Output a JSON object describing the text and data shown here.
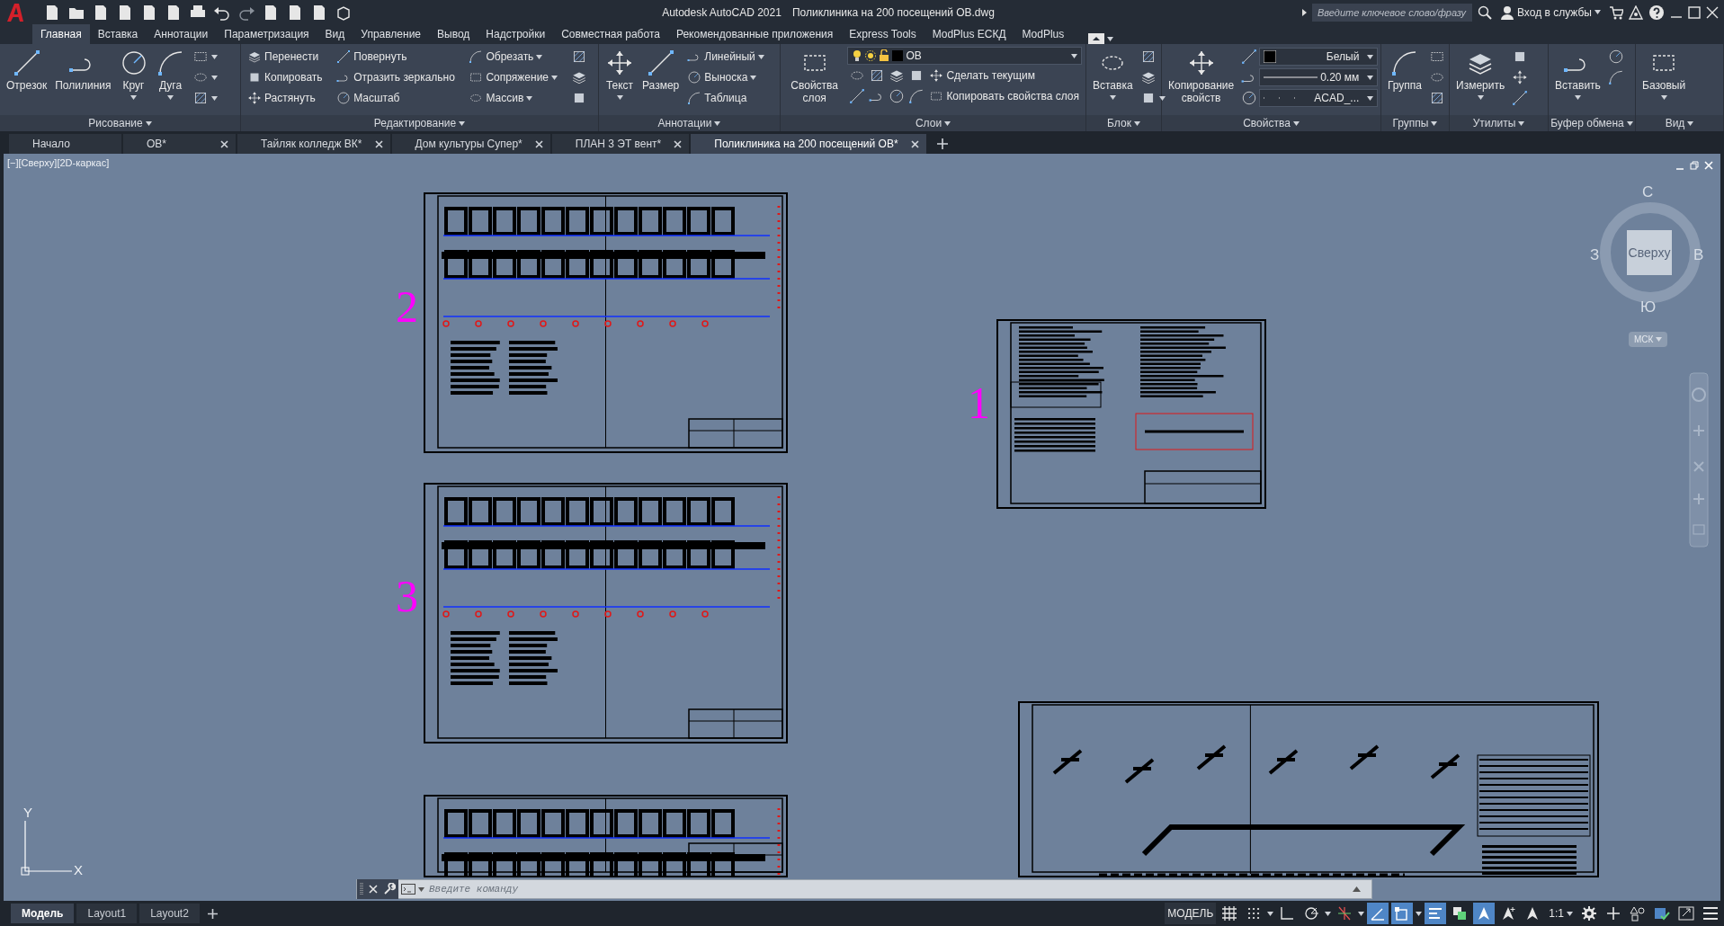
{
  "title_bar": {
    "app_title": "Autodesk AutoCAD 2021",
    "file_name": "Поликлиника на 200 посещений ОВ.dwg",
    "search": {
      "placeholder": "Введите ключевое слово/фразу"
    },
    "sign_in": "Вход в службы"
  },
  "ribbon_tabs": [
    {
      "label": "Главная",
      "selected": true
    },
    {
      "label": "Вставка",
      "selected": false
    },
    {
      "label": "Аннотации",
      "selected": false
    },
    {
      "label": "Параметризация",
      "selected": false
    },
    {
      "label": "Вид",
      "selected": false
    },
    {
      "label": "Управление",
      "selected": false
    },
    {
      "label": "Вывод",
      "selected": false
    },
    {
      "label": "Надстройки",
      "selected": false
    },
    {
      "label": "Совместная работа",
      "selected": false
    },
    {
      "label": "Рекомендованные приложения",
      "selected": false
    },
    {
      "label": "Express Tools",
      "selected": false
    },
    {
      "label": "ModPlus ЕСКД",
      "selected": false
    },
    {
      "label": "ModPlus",
      "selected": false
    }
  ],
  "ribbon_panels": [
    {
      "title": "Рисование",
      "tools": [
        {
          "kind": "large",
          "label": "Отрезок",
          "has_menu": false
        },
        {
          "kind": "large",
          "label": "Полилиния",
          "has_menu": false
        },
        {
          "kind": "large",
          "label": "Круг",
          "has_menu": true
        },
        {
          "kind": "large",
          "label": "Дуга",
          "has_menu": true
        },
        {
          "kind": "icon",
          "has_menu": true
        },
        {
          "kind": "icon",
          "has_menu": true
        },
        {
          "kind": "icon",
          "has_menu": true
        }
      ]
    },
    {
      "title": "Редактирование",
      "tools": [
        {
          "kind": "small",
          "label": "Перенести",
          "has_menu": false
        },
        {
          "kind": "small",
          "label": "Копировать",
          "has_menu": false
        },
        {
          "kind": "small",
          "label": "Растянуть",
          "has_menu": false
        },
        {
          "kind": "small",
          "label": "Повернуть",
          "has_menu": false
        },
        {
          "kind": "small",
          "label": "Отразить зеркально",
          "has_menu": false
        },
        {
          "kind": "small",
          "label": "Масштаб",
          "has_menu": false
        },
        {
          "kind": "small",
          "label": "Обрезать",
          "has_menu": true
        },
        {
          "kind": "small",
          "label": "Сопряжение",
          "has_menu": true
        },
        {
          "kind": "small",
          "label": "Массив",
          "has_menu": true
        },
        {
          "kind": "icon",
          "has_menu": false
        },
        {
          "kind": "icon",
          "has_menu": false
        },
        {
          "kind": "icon",
          "has_menu": false
        }
      ]
    },
    {
      "title": "Аннотации",
      "tools": [
        {
          "kind": "large",
          "label": "Текст",
          "has_menu": true
        },
        {
          "kind": "large",
          "label": "Размер",
          "has_menu": false
        },
        {
          "kind": "small",
          "label": "Линейный",
          "has_menu": true
        },
        {
          "kind": "small",
          "label": "Выноска",
          "has_menu": true
        },
        {
          "kind": "small",
          "label": "Таблица",
          "has_menu": false
        }
      ]
    },
    {
      "title": "Слои",
      "tools": [
        {
          "kind": "large",
          "label": "Свойства слоя",
          "has_menu": false
        },
        {
          "kind": "layer-dropdown",
          "value": "ОВ"
        },
        {
          "kind": "row",
          "items": [
            {
              "kind": "icon",
              "has_menu": false
            },
            {
              "kind": "icon",
              "has_menu": false
            },
            {
              "kind": "icon",
              "has_menu": false
            },
            {
              "kind": "icon",
              "has_menu": false
            },
            {
              "kind": "small",
              "label": "Сделать текущим",
              "has_menu": false
            }
          ]
        },
        {
          "kind": "row",
          "items": [
            {
              "kind": "icon",
              "has_menu": false
            },
            {
              "kind": "icon",
              "has_menu": false
            },
            {
              "kind": "icon",
              "has_menu": false
            },
            {
              "kind": "icon",
              "has_menu": false
            },
            {
              "kind": "small",
              "label": "Копировать свойства слоя",
              "has_menu": false
            }
          ]
        }
      ]
    },
    {
      "title": "Блок",
      "tools": [
        {
          "kind": "large",
          "label": "Вставка",
          "has_menu": true
        },
        {
          "kind": "icon",
          "has_menu": false
        },
        {
          "kind": "icon",
          "has_menu": false
        },
        {
          "kind": "icon",
          "has_menu": true
        }
      ]
    },
    {
      "title": "Свойства",
      "tools": [
        {
          "kind": "large",
          "label": "Копирование свойств",
          "has_menu": false
        },
        {
          "kind": "row",
          "items": [
            {
              "kind": "icon",
              "has_menu": false
            },
            {
              "kind": "color-dropdown",
              "value": "Белый"
            }
          ]
        },
        {
          "kind": "row",
          "items": [
            {
              "kind": "icon",
              "has_menu": false
            },
            {
              "kind": "lineweight-dropdown",
              "value": "0.20 мм"
            }
          ]
        },
        {
          "kind": "row",
          "items": [
            {
              "kind": "icon",
              "has_menu": false
            },
            {
              "kind": "linetype-dropdown",
              "value": "ACAD_..."
            }
          ]
        }
      ]
    },
    {
      "title": "Группы",
      "tools": [
        {
          "kind": "large",
          "label": "Группа",
          "has_menu": false
        },
        {
          "kind": "icon",
          "has_menu": false
        },
        {
          "kind": "icon",
          "has_menu": false
        },
        {
          "kind": "icon",
          "has_menu": false
        }
      ]
    },
    {
      "title": "Утилиты",
      "tools": [
        {
          "kind": "large",
          "label": "Измерить",
          "has_menu": true
        },
        {
          "kind": "icon",
          "has_menu": false
        },
        {
          "kind": "icon",
          "has_menu": false
        },
        {
          "kind": "icon",
          "has_menu": false
        }
      ]
    },
    {
      "title": "Буфер обмена",
      "tools": [
        {
          "kind": "large",
          "label": "Вставить",
          "has_menu": true
        },
        {
          "kind": "icon",
          "has_menu": false
        },
        {
          "kind": "icon",
          "has_menu": false
        }
      ]
    },
    {
      "title": "Вид",
      "tools": [
        {
          "kind": "large",
          "label": "Базовый",
          "has_menu": true
        }
      ]
    }
  ],
  "document_tabs": [
    {
      "label": "Начало",
      "selected": false,
      "closable": false
    },
    {
      "label": "ОВ*",
      "selected": false,
      "closable": true
    },
    {
      "label": "Тайляк колледж ВК*",
      "selected": false,
      "closable": true
    },
    {
      "label": "Дом культуры Супер*",
      "selected": false,
      "closable": true
    },
    {
      "label": "ПЛАН 3 ЭТ вент*",
      "selected": false,
      "closable": true
    },
    {
      "label": "Поликлиника на 200 посещений ОВ*",
      "selected": true,
      "closable": true
    }
  ],
  "viewport": {
    "label": "[−][Сверху][2D-каркас]",
    "view_cube": {
      "face": "Сверху",
      "north": "С",
      "west": "З",
      "east": "В",
      "south": "Ю",
      "ucs": "МСК"
    },
    "ucs_axes": {
      "y": "Y",
      "x": "X"
    },
    "sheets": [
      {
        "kind": "plan",
        "number": "2"
      },
      {
        "kind": "plan",
        "number": "3"
      },
      {
        "kind": "plan"
      },
      {
        "kind": "notes",
        "number": "1"
      },
      {
        "kind": "schematic"
      }
    ]
  },
  "command_line": {
    "placeholder": "Введите команду"
  },
  "layout_tabs": [
    {
      "label": "Модель",
      "selected": true
    },
    {
      "label": "Layout1",
      "selected": false
    },
    {
      "label": "Layout2",
      "selected": false
    }
  ],
  "status_bar": {
    "model_label": "МОДЕЛЬ",
    "scale": "1:1",
    "toggles": [
      {
        "on": false
      },
      {
        "on": false
      },
      {
        "on": false
      },
      {
        "on": false
      },
      {
        "on": false
      },
      {
        "on": true
      },
      {
        "on": true
      },
      {
        "on": true
      },
      {
        "on": false
      },
      {
        "on": true
      },
      {
        "on": false
      },
      {
        "on": false
      }
    ]
  }
}
